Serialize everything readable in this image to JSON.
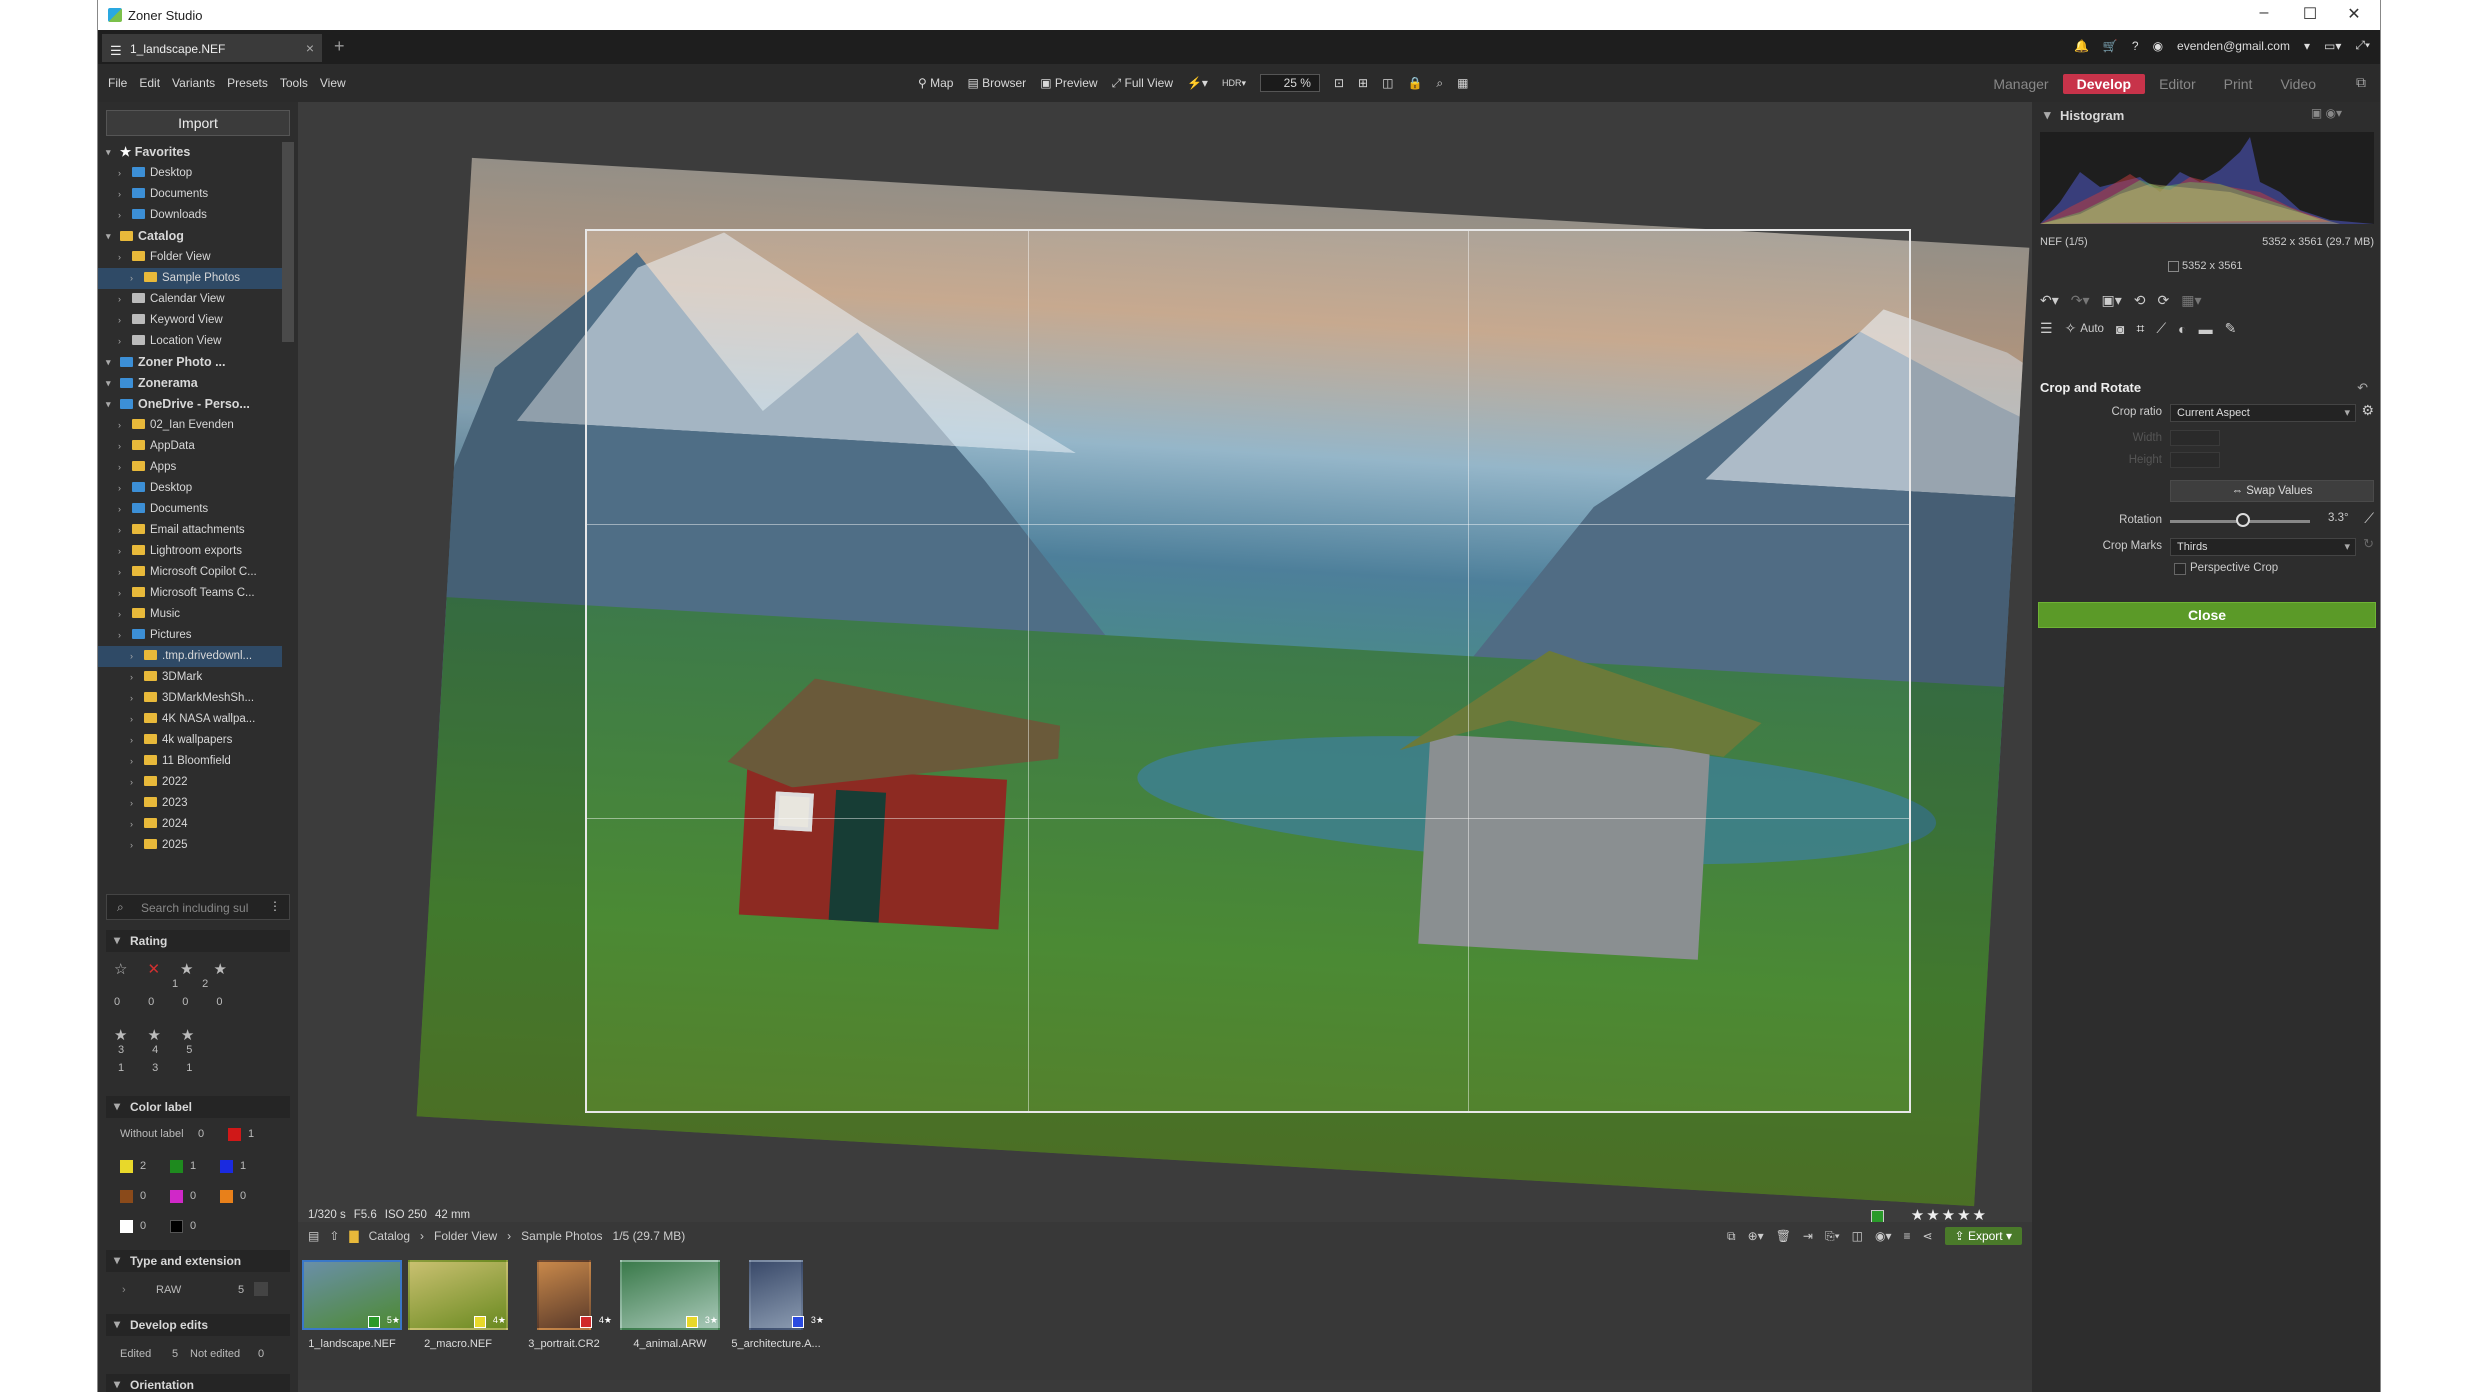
{
  "app": {
    "title": "Zoner Studio",
    "doc_tab": "1_landscape.NEF",
    "user": "evenden@gmail.com"
  },
  "menu": [
    "File",
    "Edit",
    "Variants",
    "Presets",
    "Tools",
    "View"
  ],
  "toolbar": {
    "map": "Map",
    "browser": "Browser",
    "preview": "Preview",
    "full_view": "Full View",
    "zoom": "25 %"
  },
  "modes": {
    "manager": "Manager",
    "develop": "Develop",
    "editor": "Editor",
    "print": "Print",
    "video": "Video"
  },
  "left": {
    "import": "Import",
    "tree": [
      {
        "label": "Favorites",
        "lvl": 0,
        "hdr": true,
        "icon": "star"
      },
      {
        "label": "Desktop",
        "lvl": 1,
        "icon": "b"
      },
      {
        "label": "Documents",
        "lvl": 1,
        "icon": "b"
      },
      {
        "label": "Downloads",
        "lvl": 1,
        "icon": "b"
      },
      {
        "label": "Catalog",
        "lvl": 0,
        "hdr": true,
        "icon": "y"
      },
      {
        "label": "Folder View",
        "lvl": 1,
        "icon": "y"
      },
      {
        "label": "Sample Photos",
        "lvl": 2,
        "icon": "y",
        "sel": true
      },
      {
        "label": "Calendar View",
        "lvl": 1,
        "icon": "g"
      },
      {
        "label": "Keyword View",
        "lvl": 1,
        "icon": "g"
      },
      {
        "label": "Location View",
        "lvl": 1,
        "icon": "g"
      },
      {
        "label": "Zoner Photo ...",
        "lvl": 0,
        "hdr": true,
        "icon": "b"
      },
      {
        "label": "Zonerama",
        "lvl": 0,
        "hdr": true,
        "icon": "b"
      },
      {
        "label": "OneDrive - Perso...",
        "lvl": 0,
        "hdr": true,
        "icon": "b"
      },
      {
        "label": "02_Ian Evenden",
        "lvl": 1,
        "icon": "y"
      },
      {
        "label": "AppData",
        "lvl": 1,
        "icon": "y"
      },
      {
        "label": "Apps",
        "lvl": 1,
        "icon": "y"
      },
      {
        "label": "Desktop",
        "lvl": 1,
        "icon": "b"
      },
      {
        "label": "Documents",
        "lvl": 1,
        "icon": "b"
      },
      {
        "label": "Email attachments",
        "lvl": 1,
        "icon": "y"
      },
      {
        "label": "Lightroom exports",
        "lvl": 1,
        "icon": "y"
      },
      {
        "label": "Microsoft Copilot C...",
        "lvl": 1,
        "icon": "y"
      },
      {
        "label": "Microsoft Teams C...",
        "lvl": 1,
        "icon": "y"
      },
      {
        "label": "Music",
        "lvl": 1,
        "icon": "y"
      },
      {
        "label": "Pictures",
        "lvl": 1,
        "icon": "b"
      },
      {
        "label": ".tmp.drivedownl...",
        "lvl": 2,
        "icon": "y",
        "sel": true
      },
      {
        "label": "3DMark",
        "lvl": 2,
        "icon": "y"
      },
      {
        "label": "3DMarkMeshSh...",
        "lvl": 2,
        "icon": "y"
      },
      {
        "label": "4K NASA wallpa...",
        "lvl": 2,
        "icon": "y"
      },
      {
        "label": "4k wallpapers",
        "lvl": 2,
        "icon": "y"
      },
      {
        "label": "11 Bloomfield",
        "lvl": 2,
        "icon": "y"
      },
      {
        "label": "2022",
        "lvl": 2,
        "icon": "y"
      },
      {
        "label": "2023",
        "lvl": 2,
        "icon": "y"
      },
      {
        "label": "2024",
        "lvl": 2,
        "icon": "y"
      },
      {
        "label": "2025",
        "lvl": 2,
        "icon": "y"
      }
    ],
    "search_placeholder": "Search including sul",
    "rating": {
      "title": "Rating",
      "counts1": [
        "0",
        "0",
        "0",
        "0"
      ],
      "labels1": [
        "",
        "",
        "1",
        "2"
      ],
      "labels2": [
        "3",
        "4",
        "5"
      ],
      "counts2": [
        "1",
        "3",
        "1"
      ]
    },
    "color_label": {
      "title": "Color label",
      "without": "Without label",
      "without_count": "0",
      "red_count": "1",
      "yellow": "2",
      "green": "1",
      "blue": "1",
      "brown": "0",
      "magenta": "0",
      "orange": "0",
      "white": "0",
      "black": "0"
    },
    "type_ext": {
      "title": "Type and extension",
      "raw": "RAW",
      "raw_count": "5"
    },
    "develop_edits": {
      "title": "Develop edits",
      "edited": "Edited",
      "edited_count": "5",
      "not_edited": "Not edited",
      "not_edited_count": "0"
    },
    "orientation": "Orientation"
  },
  "canvas": {
    "exif": [
      "1/320 s",
      "F5.6",
      "ISO 250",
      "42 mm"
    ],
    "stars": "★★★★★"
  },
  "filmbar": {
    "crumbs": [
      "Catalog",
      "Folder View",
      "Sample Photos"
    ],
    "count": "1/5 (29.7 MB)",
    "export": "Export"
  },
  "film": [
    {
      "name": "1_landscape.NEF",
      "sel": true,
      "label": "#2a9a2a",
      "stars": "5★",
      "c1": "#6a8fa8",
      "c2": "#4d8a32"
    },
    {
      "name": "2_macro.NEF",
      "label": "#e8d82a",
      "stars": "4★",
      "c1": "#c9c070",
      "c2": "#6a8a20"
    },
    {
      "name": "3_portrait.CR2",
      "label": "#d02a2a",
      "stars": "4★",
      "c1": "#c8884a",
      "c2": "#5a3a2a"
    },
    {
      "name": "4_animal.ARW",
      "label": "#e8d82a",
      "stars": "3★",
      "c1": "#3a7a4a",
      "c2": "#a8c8b8"
    },
    {
      "name": "5_architecture.A...",
      "label": "#2a4ae0",
      "stars": "3★",
      "c1": "#3a4a6a",
      "c2": "#8a9ab0"
    }
  ],
  "right": {
    "histogram": "Histogram",
    "file_info": "NEF  (1/5)",
    "file_size": "5352 x 3561 (29.7 MB)",
    "dims": "5352 x 3561",
    "auto": "Auto",
    "crop_title": "Crop and Rotate",
    "crop_ratio_label": "Crop ratio",
    "crop_ratio": "Current Aspect",
    "width_label": "Width",
    "height_label": "Height",
    "swap": "Swap Values",
    "rotation_label": "Rotation",
    "rotation_value": "3.3°",
    "rotation_fraction": 0.52,
    "crop_marks_label": "Crop Marks",
    "crop_marks": "Thirds",
    "perspective": "Perspective Crop",
    "close": "Close"
  }
}
